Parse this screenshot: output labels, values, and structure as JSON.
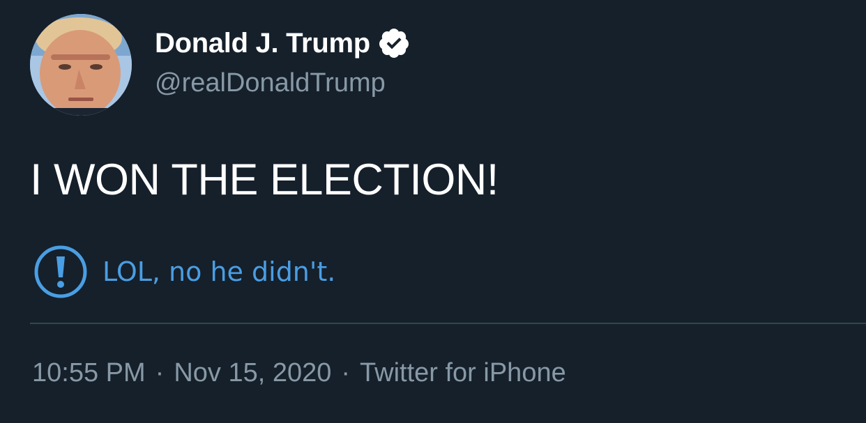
{
  "author": {
    "name": "Donald J. Trump",
    "handle": "@realDonaldTrump",
    "verified": true,
    "avatar_icon": "profile-photo"
  },
  "tweet": {
    "text": "I WON THE ELECTION!"
  },
  "notice": {
    "icon": "exclamation-circle-icon",
    "text": "LOL, no he didn't.",
    "color": "#4a9ee3"
  },
  "meta": {
    "time": "10:55 PM",
    "separator": "·",
    "date": "Nov 15, 2020",
    "source": "Twitter for iPhone"
  },
  "colors": {
    "background": "#15202b",
    "primary_text": "#ffffff",
    "secondary_text": "#8899a6",
    "divider": "#38444d",
    "verified_badge": "#ffffff"
  }
}
